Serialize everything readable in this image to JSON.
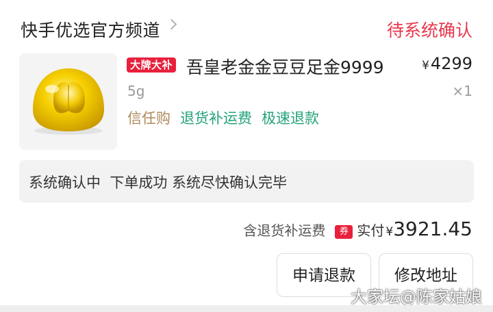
{
  "header": {
    "shop_name": "快手优选官方频道",
    "status": "待系统确认"
  },
  "product": {
    "badge": "大牌大补",
    "title": "吾皇老金金豆豆足金9999",
    "price_symbol": "¥",
    "price": "4299",
    "spec": "5g",
    "quantity": "×1",
    "tags": [
      "信任购",
      "退货补运费",
      "极速退款"
    ],
    "image_icon": "gold-bean-icon"
  },
  "status_box": {
    "text": "系统确认中  下单成功 系统尽快确认完毕"
  },
  "total": {
    "note": "含退货补运费",
    "coupon": "券",
    "label": "实付",
    "currency": "¥",
    "amount": "3921.45"
  },
  "actions": {
    "refund_label": "申请退款",
    "change_address_label": "修改地址"
  },
  "watermark": "大家坛@陈家姑娘",
  "colors": {
    "accent_red": "#e8384c",
    "tag_gold": "#b0895a",
    "tag_green": "#22a27a"
  }
}
